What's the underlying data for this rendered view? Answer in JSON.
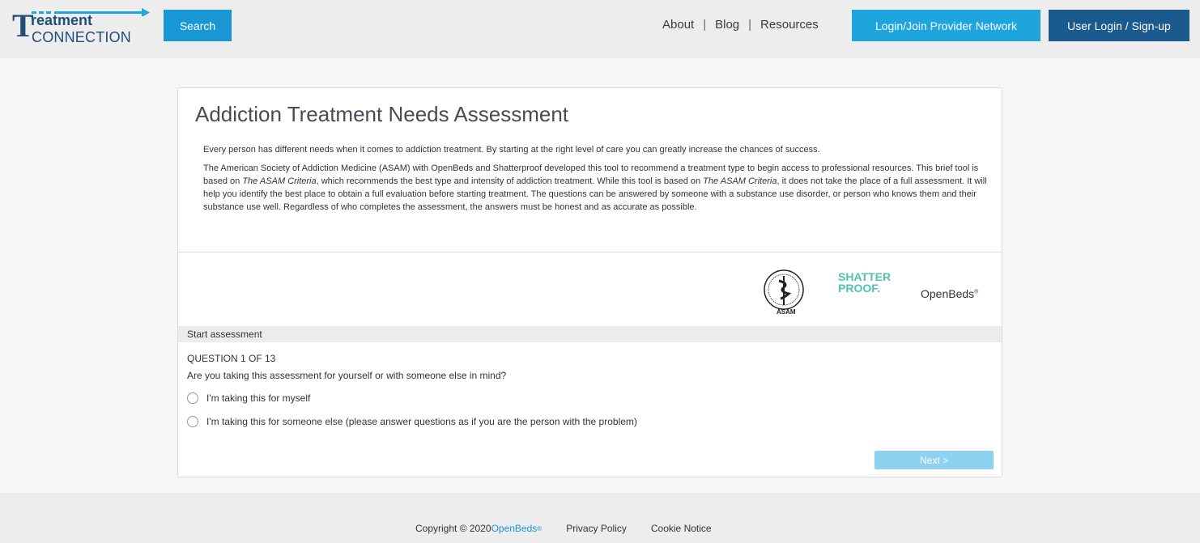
{
  "header": {
    "logo_line1": "reatment",
    "logo_line2": "CONNECTION",
    "search_label": "Search",
    "nav": [
      {
        "label": "About"
      },
      {
        "label": "Blog"
      },
      {
        "label": "Resources"
      }
    ],
    "nav_separator": "|",
    "provider_label": "Login/Join Provider Network",
    "user_login_label": "User Login / Sign-up"
  },
  "card": {
    "title": "Addiction Treatment Needs Assessment",
    "intro_p1": "Every person has different needs when it comes to addiction treatment. By starting at the right level of care you can greatly increase the chances of success.",
    "intro_p2_a": "The American Society of Addiction Medicine (ASAM) with OpenBeds and Shatterproof developed this tool to recommend a treatment type to begin access to professional resources. This brief tool is based on ",
    "intro_p2_em1": "The ASAM Criteria",
    "intro_p2_b": ", which recommends the best type and intensity of addiction treatment. While this tool is based on ",
    "intro_p2_em2": "The ASAM Criteria",
    "intro_p2_c": ", it does not take the place of a full assessment. It will help you identify the best place to obtain a full evaluation before starting treatment. The questions can be answered by someone with a substance use disorder, or person who knows them and their substance use well. Regardless of who completes the assessment, the answers must be honest and as accurate as possible.",
    "logos": {
      "asam_text": "ASAM",
      "shatter_l1": "SHATTER",
      "shatter_l2": "PROOF.",
      "openbeds": "OpenBeds"
    },
    "start_label": "Start assessment",
    "question_number": "QUESTION 1 OF 13",
    "question_text": "Are you taking this assessment for yourself or with someone else in mind?",
    "options": [
      {
        "label": "I'm taking this for myself"
      },
      {
        "label": "I'm taking this for someone else (please answer questions as if you are the person with the problem)"
      }
    ],
    "next_label": "Next >"
  },
  "footer": {
    "copyright": "Copyright © 2020 ",
    "openbeds": "OpenBeds",
    "reg": "®",
    "privacy": "Privacy Policy",
    "cookie": "Cookie Notice"
  },
  "colors": {
    "primary_blue": "#1996d4",
    "dark_blue": "#1a5a8e",
    "next_disabled": "#8dd3f1"
  }
}
